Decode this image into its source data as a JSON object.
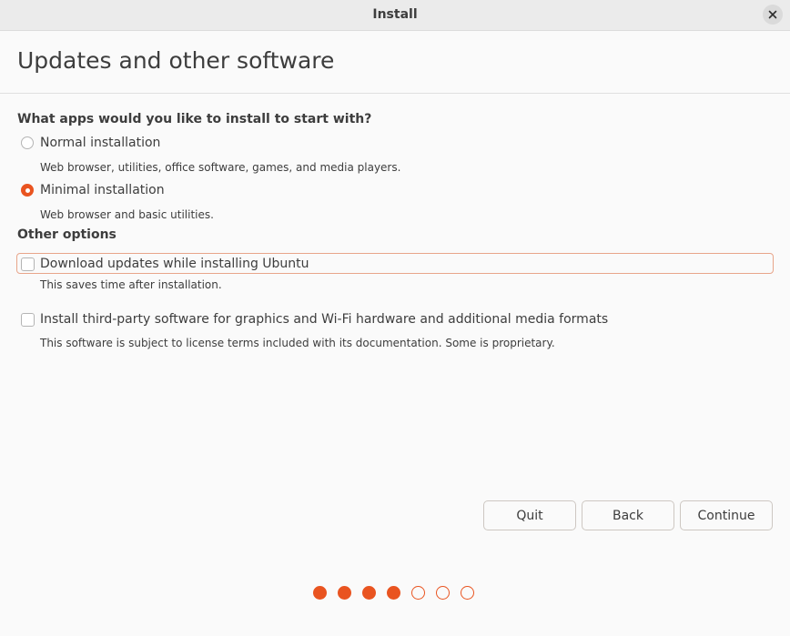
{
  "window": {
    "title": "Install",
    "close_icon": "close-icon"
  },
  "page": {
    "title": "Updates and other software"
  },
  "apps_section": {
    "question": "What apps would you like to install to start with?",
    "options": [
      {
        "label": "Normal installation",
        "description": "Web browser, utilities, office software, games, and media players.",
        "selected": false
      },
      {
        "label": "Minimal installation",
        "description": "Web browser and basic utilities.",
        "selected": true
      }
    ]
  },
  "other_section": {
    "heading": "Other options",
    "options": [
      {
        "label": "Download updates while installing Ubuntu",
        "description": "This saves time after installation.",
        "checked": false,
        "focused": true
      },
      {
        "label": "Install third-party software for graphics and Wi-Fi hardware and additional media formats",
        "description": "This software is subject to license terms included with its documentation. Some is proprietary.",
        "checked": false,
        "focused": false
      }
    ]
  },
  "buttons": {
    "quit": "Quit",
    "back": "Back",
    "continue": "Continue"
  },
  "progress": {
    "total_steps": 7,
    "completed_steps": 4
  },
  "colors": {
    "accent": "#e95420",
    "focus_ring": "#e8a58a"
  }
}
